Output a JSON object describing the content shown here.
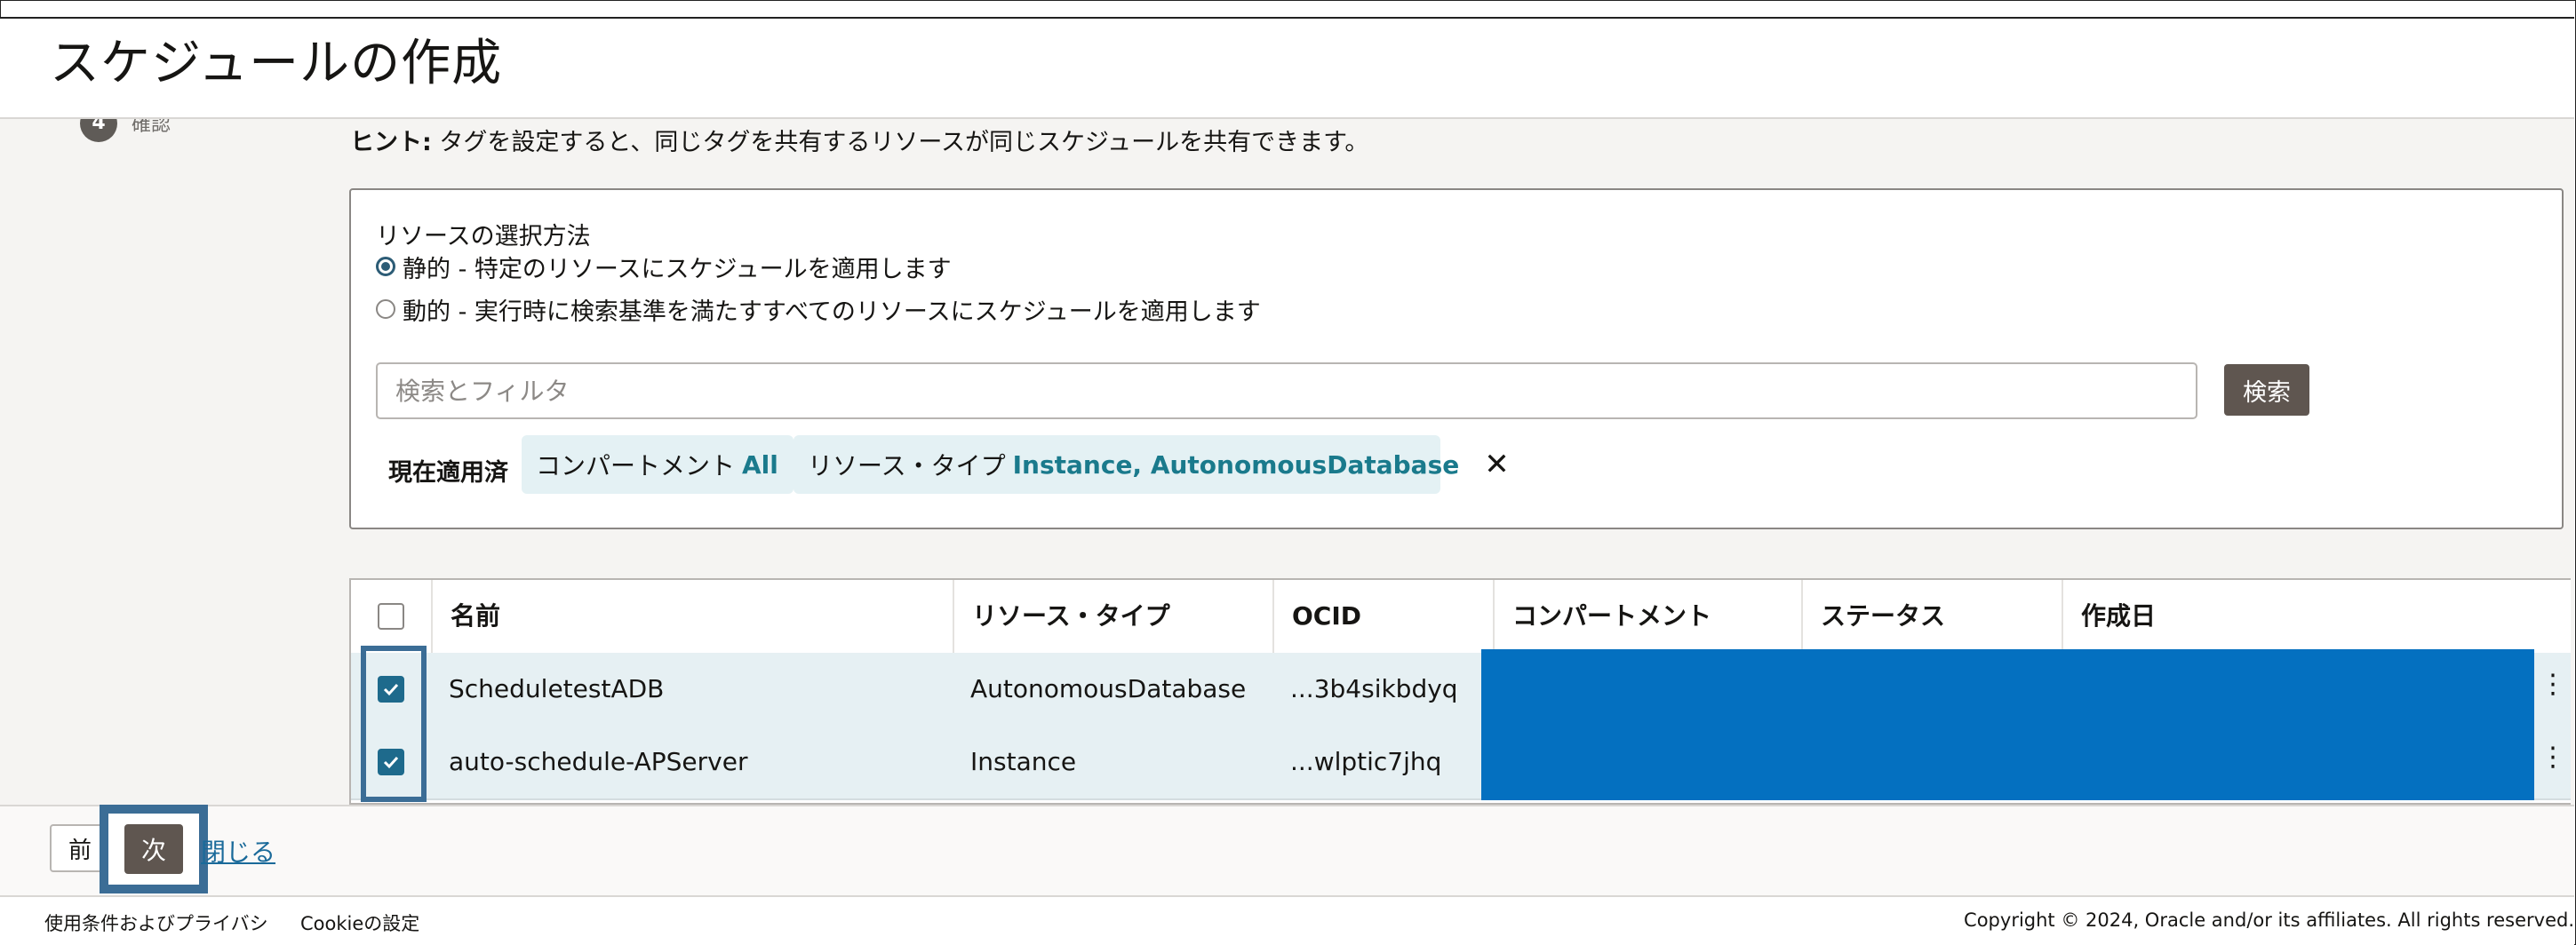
{
  "header": {
    "title": "スケジュールの作成"
  },
  "step": {
    "number": "4",
    "label": "確認"
  },
  "hint": {
    "label": "ヒント:",
    "text": " タグを設定すると、同じタグを共有するリソースが同じスケジュールを共有できます。"
  },
  "selection": {
    "title": "リソースの選択方法",
    "options": [
      {
        "label": "静的 - 特定のリソースにスケジュールを適用します",
        "selected": true
      },
      {
        "label": "動的 - 実行時に検索基準を満たすすべてのリソースにスケジュールを適用します",
        "selected": false
      }
    ]
  },
  "search": {
    "placeholder": "検索とフィルタ",
    "button_label": "検索"
  },
  "filters": {
    "applied_label": "現在適用済",
    "compartment": {
      "key": "コンパートメント",
      "value": "All"
    },
    "resource_type": {
      "key": "リソース・タイプ",
      "value": "Instance, AutonomousDatabase"
    }
  },
  "table": {
    "columns": [
      "名前",
      "リソース・タイプ",
      "OCID",
      "コンパートメント",
      "ステータス",
      "作成日"
    ],
    "rows": [
      {
        "name": "ScheduletestADB",
        "type": "AutonomousDatabase",
        "ocid": "...3b4sikbdyq",
        "checked": true
      },
      {
        "name": "auto-schedule-APServer",
        "type": "Instance",
        "ocid": "...wlptic7jhq",
        "checked": true
      }
    ],
    "redaction_color": "#0470c0"
  },
  "footer": {
    "prev_label": "前",
    "next_label": "次",
    "close_label": "閉じる"
  },
  "legal": {
    "terms": "使用条件およびプライバシ",
    "cookie": "Cookieの設定",
    "copyright": "Copyright © 2024, Oracle and/or its affiliates. All rights reserved."
  },
  "colors": {
    "accent": "#3b6d96",
    "chip_bg": "#e4f1f4",
    "primary_button": "#5f5650"
  }
}
